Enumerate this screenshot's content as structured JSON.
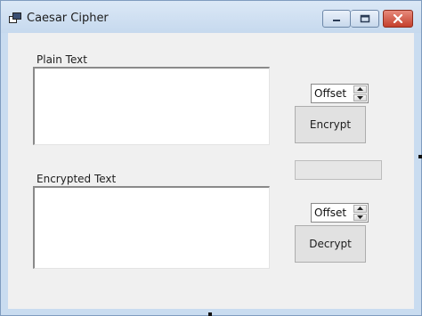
{
  "window": {
    "title": "Caesar Cipher",
    "icon": "windows-app-icon",
    "controls": {
      "minimize": "minimize-icon",
      "maximize": "maximize-icon",
      "close": "close-icon"
    }
  },
  "plain": {
    "label": "Plain Text",
    "value": ""
  },
  "encrypted": {
    "label": "Encrypted Text",
    "value": ""
  },
  "encrypt_offset": {
    "value": "Offset"
  },
  "decrypt_offset": {
    "value": "Offset"
  },
  "buttons": {
    "encrypt": "Encrypt",
    "decrypt": "Decrypt"
  },
  "status": {
    "value": ""
  },
  "colors": {
    "window_frame": "#c9dcf0",
    "client_background": "#f0f0f0",
    "close_button": "#c4402d",
    "button_face": "#e1e1e1"
  }
}
